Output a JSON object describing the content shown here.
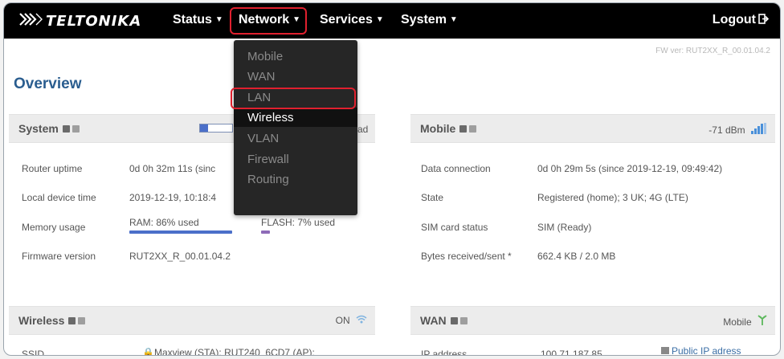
{
  "brand": {
    "name": "TELTONIKA"
  },
  "nav": {
    "status": "Status",
    "network": "Network",
    "services": "Services",
    "system": "System",
    "logout": "Logout"
  },
  "network_menu": {
    "items": [
      "Mobile",
      "WAN",
      "LAN",
      "Wireless",
      "VLAN",
      "Firewall",
      "Routing"
    ],
    "hovered": "Wireless",
    "highlighted": "LAN"
  },
  "firmware_header": "FW ver: RUT2XX_R_00.01.04.2",
  "page_title": "Overview",
  "system_panel": {
    "title": "System",
    "header_value_partial": "ad",
    "rows": [
      {
        "label": "Router uptime",
        "value": "0d 0h 32m 11s (sinc"
      },
      {
        "label": "Local device time",
        "value": "2019-12-19, 10:18:4"
      },
      {
        "label": "Memory usage",
        "value": "RAM: 86% used",
        "value2": "FLASH: 7% used",
        "ram_pct": 86,
        "flash_pct": 7
      },
      {
        "label": "Firmware version",
        "value": "RUT2XX_R_00.01.04.2"
      }
    ]
  },
  "mobile_panel": {
    "title": "Mobile",
    "signal": "-71 dBm",
    "rows": [
      {
        "label": "Data connection",
        "value": "0d 0h 29m 5s (since 2019-12-19, 09:49:42)"
      },
      {
        "label": "State",
        "value": "Registered (home); 3 UK; 4G (LTE)"
      },
      {
        "label": "SIM card status",
        "value": "SIM (Ready)"
      },
      {
        "label": "Bytes received/sent *",
        "value": "662.4 KB / 2.0 MB"
      }
    ]
  },
  "wireless_panel": {
    "title": "Wireless",
    "status": "ON",
    "rows": [
      {
        "label": "SSID",
        "value": "Maxview (STA); RUT240_6CD7 (AP);"
      }
    ]
  },
  "wan_panel": {
    "title": "WAN",
    "status": "Mobile",
    "rows": [
      {
        "label": "IP address",
        "value": "100.71.187.85",
        "extra": "Public IP adress"
      }
    ]
  },
  "colors": {
    "navbar": "#000000",
    "highlight": "#e0202e",
    "accent_blue": "#2a5d8f",
    "ram_bar": "#4b6fc9",
    "flash_bar": "#8e6bb8"
  },
  "icons": [
    "teltonika-logo-icon",
    "caret-down-icon",
    "logout-icon",
    "signal-bars-icon",
    "wifi-icon",
    "mobile-antenna-icon",
    "info-icon",
    "settings-icon",
    "lock-icon",
    "public-ip-icon"
  ]
}
